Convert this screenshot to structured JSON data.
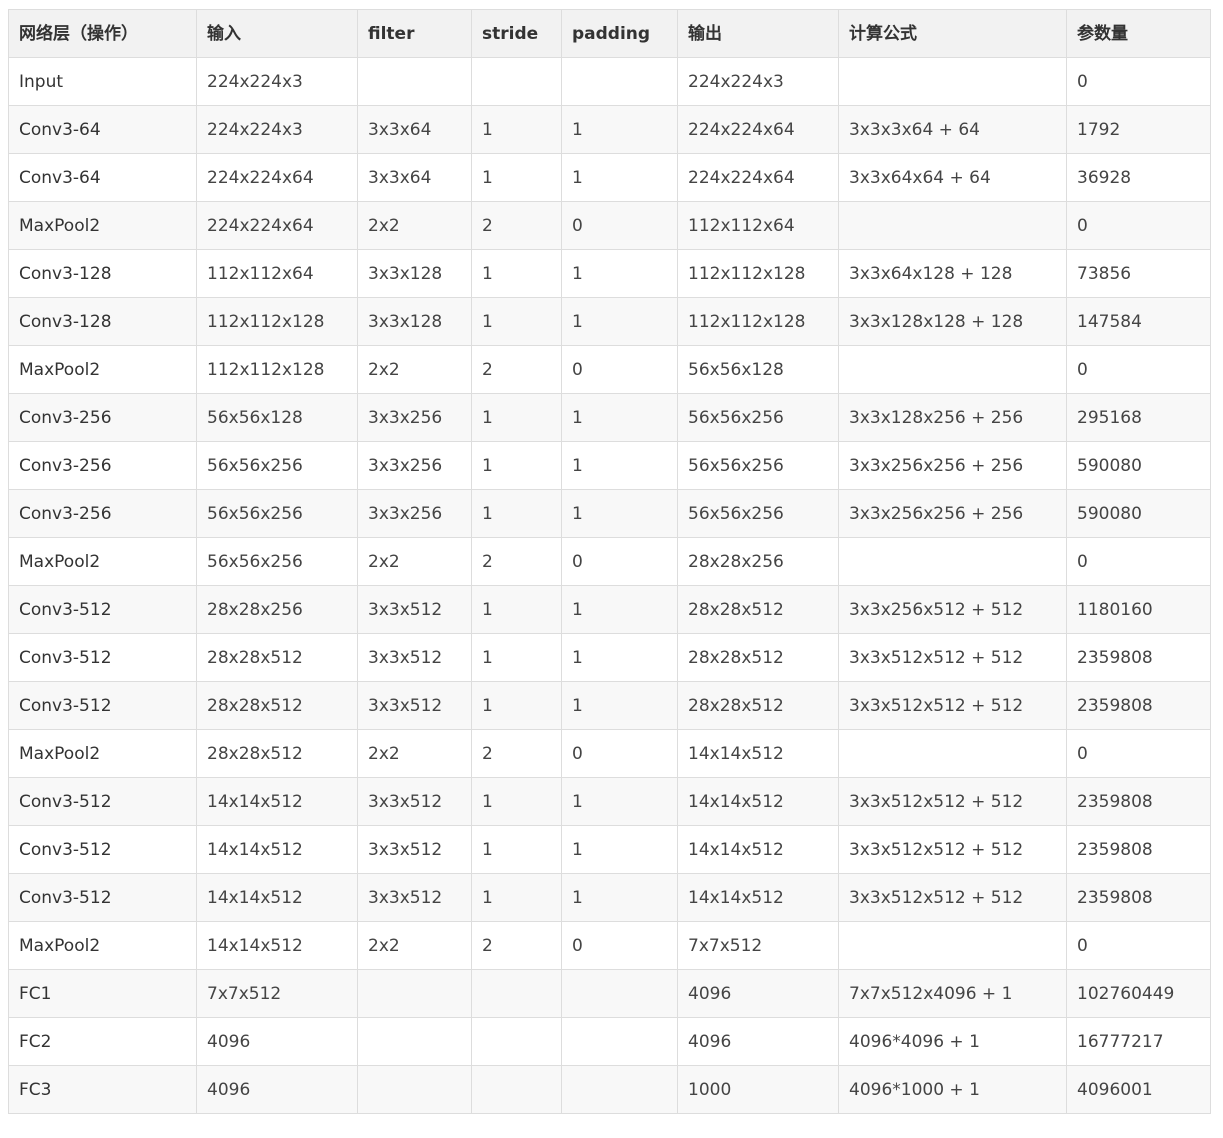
{
  "table": {
    "headers": [
      "网络层（操作）",
      "输入",
      "filter",
      "stride",
      "padding",
      "输出",
      "计算公式",
      "参数量"
    ],
    "rows": [
      [
        "Input",
        "224x224x3",
        "",
        "",
        "",
        "224x224x3",
        "",
        "0"
      ],
      [
        "Conv3-64",
        "224x224x3",
        "3x3x64",
        "1",
        "1",
        "224x224x64",
        "3x3x3x64 + 64",
        "1792"
      ],
      [
        "Conv3-64",
        "224x224x64",
        "3x3x64",
        "1",
        "1",
        "224x224x64",
        "3x3x64x64 + 64",
        "36928"
      ],
      [
        "MaxPool2",
        "224x224x64",
        "2x2",
        "2",
        "0",
        "112x112x64",
        "",
        "0"
      ],
      [
        "Conv3-128",
        "112x112x64",
        "3x3x128",
        "1",
        "1",
        "112x112x128",
        "3x3x64x128 + 128",
        "73856"
      ],
      [
        "Conv3-128",
        "112x112x128",
        "3x3x128",
        "1",
        "1",
        "112x112x128",
        "3x3x128x128 + 128",
        "147584"
      ],
      [
        "MaxPool2",
        "112x112x128",
        "2x2",
        "2",
        "0",
        "56x56x128",
        "",
        "0"
      ],
      [
        "Conv3-256",
        "56x56x128",
        "3x3x256",
        "1",
        "1",
        "56x56x256",
        "3x3x128x256 + 256",
        "295168"
      ],
      [
        "Conv3-256",
        "56x56x256",
        "3x3x256",
        "1",
        "1",
        "56x56x256",
        "3x3x256x256 + 256",
        "590080"
      ],
      [
        "Conv3-256",
        "56x56x256",
        "3x3x256",
        "1",
        "1",
        "56x56x256",
        "3x3x256x256 + 256",
        "590080"
      ],
      [
        "MaxPool2",
        "56x56x256",
        "2x2",
        "2",
        "0",
        "28x28x256",
        "",
        "0"
      ],
      [
        "Conv3-512",
        "28x28x256",
        "3x3x512",
        "1",
        "1",
        "28x28x512",
        "3x3x256x512 + 512",
        "1180160"
      ],
      [
        "Conv3-512",
        "28x28x512",
        "3x3x512",
        "1",
        "1",
        "28x28x512",
        "3x3x512x512 + 512",
        "2359808"
      ],
      [
        "Conv3-512",
        "28x28x512",
        "3x3x512",
        "1",
        "1",
        "28x28x512",
        "3x3x512x512 + 512",
        "2359808"
      ],
      [
        "MaxPool2",
        "28x28x512",
        "2x2",
        "2",
        "0",
        "14x14x512",
        "",
        "0"
      ],
      [
        "Conv3-512",
        "14x14x512",
        "3x3x512",
        "1",
        "1",
        "14x14x512",
        "3x3x512x512 + 512",
        "2359808"
      ],
      [
        "Conv3-512",
        "14x14x512",
        "3x3x512",
        "1",
        "1",
        "14x14x512",
        "3x3x512x512 + 512",
        "2359808"
      ],
      [
        "Conv3-512",
        "14x14x512",
        "3x3x512",
        "1",
        "1",
        "14x14x512",
        "3x3x512x512 + 512",
        "2359808"
      ],
      [
        "MaxPool2",
        "14x14x512",
        "2x2",
        "2",
        "0",
        "7x7x512",
        "",
        "0"
      ],
      [
        "FC1",
        "7x7x512",
        "",
        "",
        "",
        "4096",
        "7x7x512x4096 + 1",
        "102760449"
      ],
      [
        "FC2",
        "4096",
        "",
        "",
        "",
        "4096",
        "4096*4096 + 1",
        "16777217"
      ],
      [
        "FC3",
        "4096",
        "",
        "",
        "",
        "1000",
        "4096*1000 + 1",
        "4096001"
      ]
    ]
  },
  "colors": {
    "header_bg": "#f2f2f2",
    "stripe_bg": "#f8f8f8",
    "border": "#dddddd",
    "text": "#333333"
  }
}
